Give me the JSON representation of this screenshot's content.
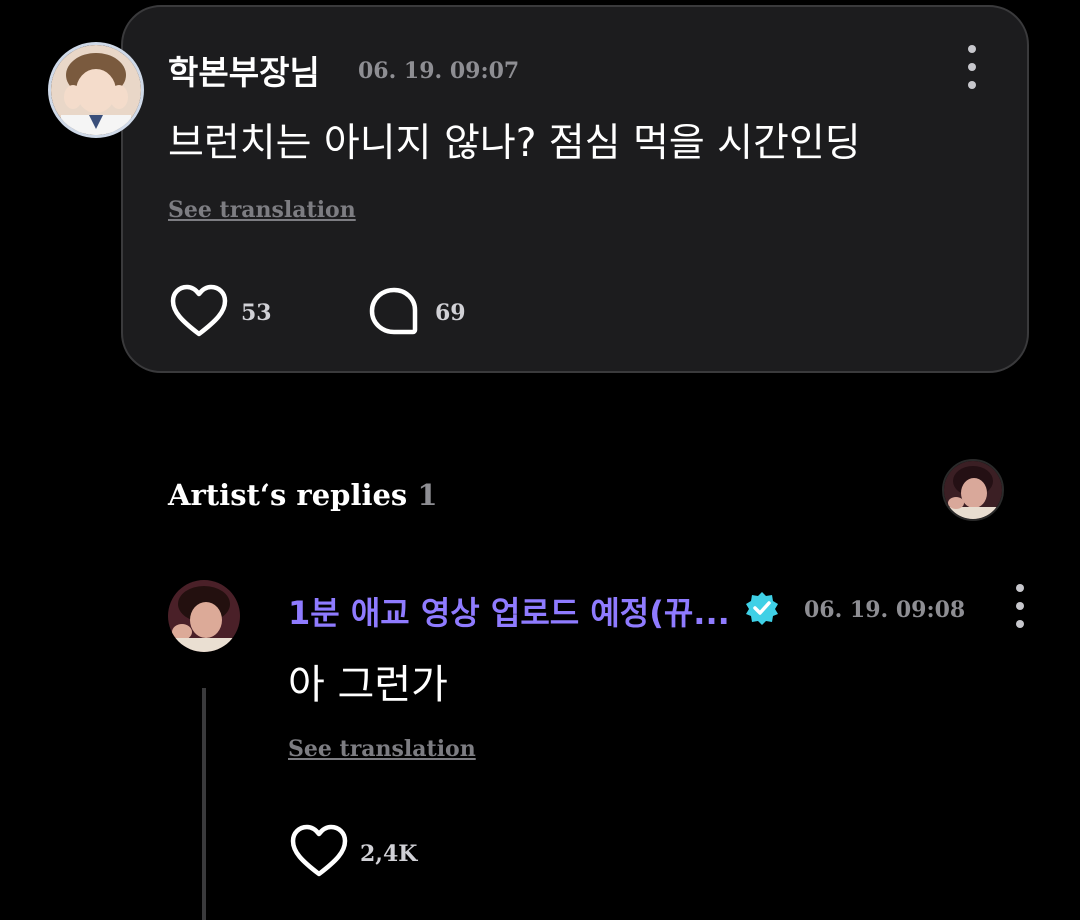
{
  "post": {
    "author": "학본부장님",
    "timestamp": "06. 19. 09:07",
    "text": "브런치는 아니지 않나? 점심 먹을 시간인딩",
    "see_translation": "See translation",
    "like_count": "53",
    "comment_count": "69",
    "icons": [
      "heart-icon",
      "comment-bubble-icon",
      "more-vertical-icon"
    ]
  },
  "artist_replies": {
    "title": "Artist‘s replies",
    "count": "1"
  },
  "reply": {
    "author": "1분 애교 영상 업로드 예정(뀨...",
    "verified": true,
    "timestamp": "06. 19. 09:08",
    "text": "아 그런가",
    "see_translation": "See translation",
    "like_count": "2,4K",
    "icons": [
      "verified-badge-icon",
      "heart-icon",
      "more-vertical-icon"
    ]
  },
  "colors": {
    "background": "#000000",
    "card": "#1c1c1e",
    "card_border": "#3a3a3c",
    "artist_name": "#8f7bff",
    "verified_badge": "#3fd0e6",
    "muted_text": "#8e8e93"
  }
}
